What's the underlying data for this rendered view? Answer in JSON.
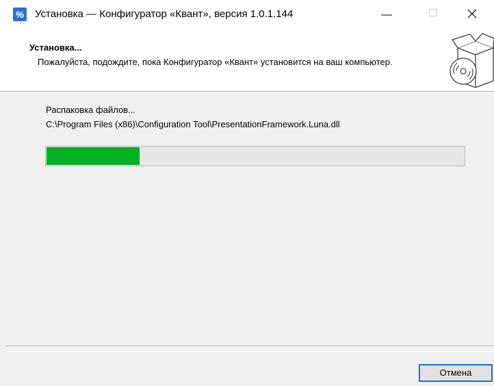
{
  "window": {
    "title": "Установка — Конфигуратор «Квант», версия 1.0.1.144",
    "icon": "installer-app-icon",
    "icon_glyph": "%",
    "controls": {
      "minimize_icon": "minimize-icon",
      "maximize_icon": "maximize-icon",
      "close_icon": "close-icon"
    }
  },
  "header": {
    "title": "Установка...",
    "description": "Пожалуйста, подождите, пока Конфигуратор «Квант» установится на ваш компьютер.",
    "icon": "install-box-disc-icon"
  },
  "status": {
    "label": "Распаковка файлов...",
    "current_file": "C:\\Program Files (x86)\\Configuration Tool\\PresentationFramework.Luna.dll"
  },
  "progress": {
    "fraction": 0.225
  },
  "footer": {
    "cancel_label": "Отмена"
  },
  "colors": {
    "progress_fill": "#06b025",
    "progress_track": "#e6e6e6",
    "accent": "#0078d7",
    "app_icon": "#2b6fd8"
  }
}
